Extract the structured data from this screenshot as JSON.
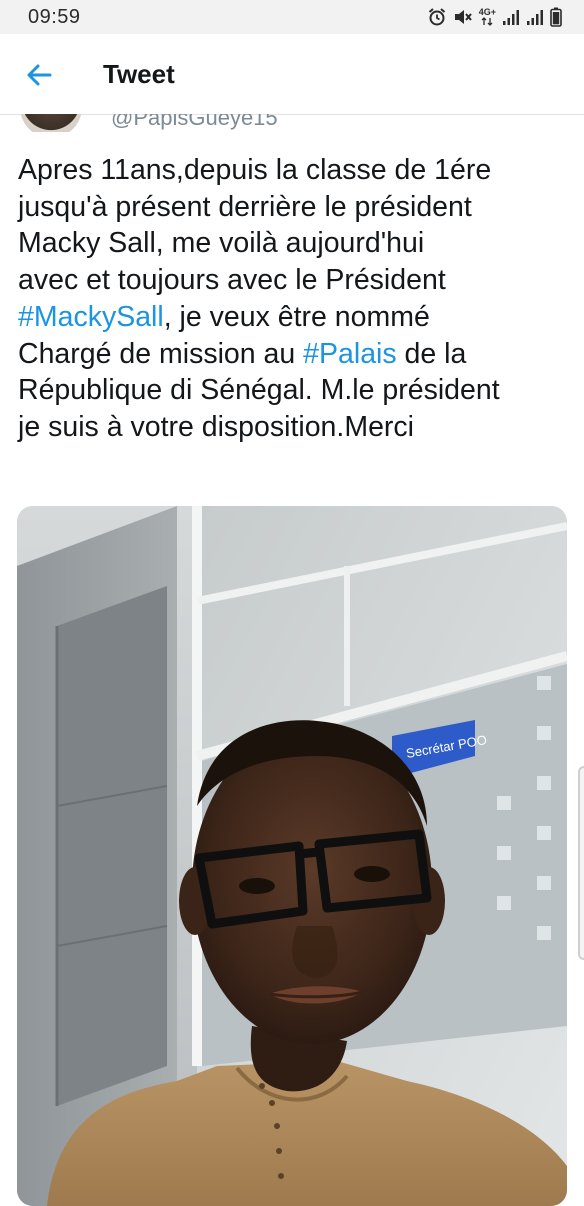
{
  "status_bar": {
    "time": "09:59",
    "network_label": "4G+",
    "icons": [
      "alarm-icon",
      "mute-icon",
      "network-arrows-icon",
      "signal-icon",
      "signal-icon",
      "battery-icon"
    ]
  },
  "header": {
    "back_icon": "arrow-left-icon",
    "title": "Tweet"
  },
  "author": {
    "handle": "@PapisGueye15"
  },
  "tweet": {
    "lines": [
      "Apres 11ans,depuis la classe de 1ére",
      "jusqu'à présent derrière le président",
      "Macky Sall, me voilà aujourd'hui",
      "avec et toujours avec le Président"
    ],
    "line5_hashtag": "#MackySall",
    "line5_rest": ", je veux être nommé",
    "line6_start": "Chargé de mission au ",
    "line6_hashtag": "#Palais",
    "line6_rest": " de la",
    "lines_end": [
      "République di Sénégal. M.le président",
      "je suis à votre disposition.Merci"
    ]
  },
  "photo": {
    "sign_text": "Secrétar POO"
  },
  "colors": {
    "accent": "#1b95e0",
    "text": "#14171a",
    "handle": "#7c8a96",
    "status_bar_bg": "#f2f2f2"
  }
}
